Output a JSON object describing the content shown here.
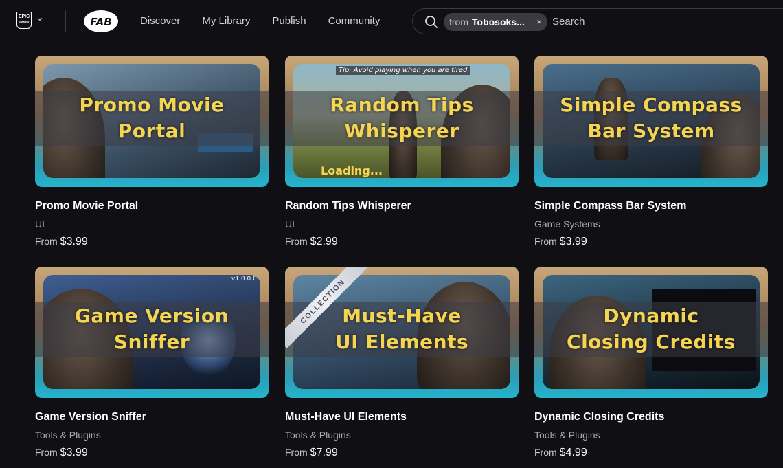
{
  "header": {
    "epic_logo_text": "EPIC",
    "epic_logo_subtext": "GAMES",
    "fab_logo_text": "FAB",
    "nav": [
      {
        "label": "Discover"
      },
      {
        "label": "My Library"
      },
      {
        "label": "Publish"
      },
      {
        "label": "Community"
      }
    ],
    "search": {
      "chip_prefix": "from",
      "chip_value": "Tobosoks...",
      "chip_close": "×",
      "placeholder": "Search"
    }
  },
  "cards": [
    {
      "thumb_line1": "Promo Movie",
      "thumb_line2": "Portal",
      "thumb_overlay": "",
      "title": "Promo Movie Portal",
      "category": "UI",
      "price_prefix": "From",
      "price": "$3.99",
      "thumb_colors": [
        "#5e7a92",
        "#2d3d4e"
      ]
    },
    {
      "thumb_line1": "Random Tips",
      "thumb_line2": "Whisperer",
      "thumb_overlay": "Tip: Avoid playing when you are tired",
      "thumb_overlay2": "Loading...",
      "title": "Random Tips Whisperer",
      "category": "UI",
      "price_prefix": "From",
      "price": "$2.99",
      "thumb_colors": [
        "#7aa4b8",
        "#5c6a3a"
      ]
    },
    {
      "thumb_line1": "Simple Compass",
      "thumb_line2": "Bar System",
      "thumb_overlay": "",
      "title": "Simple Compass Bar System",
      "category": "Game Systems",
      "price_prefix": "From",
      "price": "$3.99",
      "thumb_colors": [
        "#3d5f7a",
        "#1c2733"
      ]
    },
    {
      "thumb_line1": "Game Version",
      "thumb_line2": "Sniffer",
      "thumb_overlay": "v1.0.0.0",
      "title": "Game Version Sniffer",
      "category": "Tools & Plugins",
      "price_prefix": "From",
      "price": "$3.99",
      "thumb_colors": [
        "#2f4c78",
        "#141c2c"
      ]
    },
    {
      "thumb_line1": "Must-Have",
      "thumb_line2": "UI Elements",
      "thumb_overlay": "",
      "ribbon": "COLLECTION",
      "title": "Must-Have UI Elements",
      "category": "Tools & Plugins",
      "price_prefix": "From",
      "price": "$7.99",
      "thumb_colors": [
        "#4f7590",
        "#243444"
      ]
    },
    {
      "thumb_line1": "Dynamic",
      "thumb_line2": "Closing Credits",
      "thumb_overlay": "",
      "title": "Dynamic Closing Credits",
      "category": "Tools & Plugins",
      "price_prefix": "From",
      "price": "$4.99",
      "thumb_colors": [
        "#2e4e64",
        "#10181e"
      ]
    }
  ],
  "colors": {
    "background": "#101014",
    "thumb_title": "#f5d451",
    "accent_teal": "#26b3cc"
  }
}
